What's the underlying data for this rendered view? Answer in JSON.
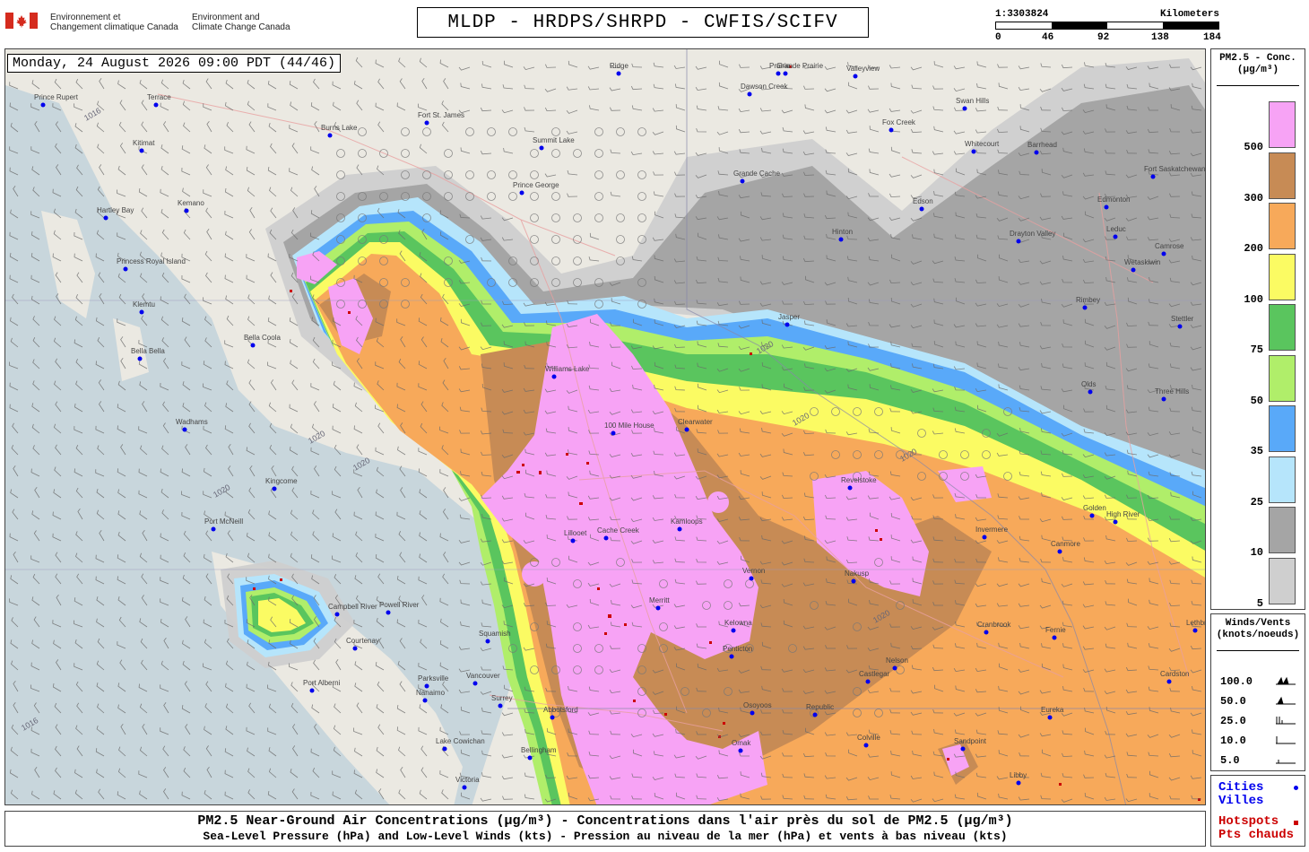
{
  "agency": {
    "fr": [
      "Environnement et",
      "Changement climatique Canada"
    ],
    "en": [
      "Environment and",
      "Climate Change Canada"
    ]
  },
  "title": "MLDP - HRDPS/SHRPD - CWFIS/SCIFV",
  "scale": {
    "ratio": "1:3303824",
    "unit": "Kilometers",
    "ticks": [
      "0",
      "46",
      "92",
      "138",
      "184"
    ]
  },
  "timestamp": "Monday, 24 August 2026 09:00 PDT (44/46)",
  "legend": {
    "title": [
      "PM2.5 - Conc.",
      "(µg/m³)"
    ],
    "bins": [
      {
        "label": "500",
        "color": "#f7a3f5"
      },
      {
        "label": "300",
        "color": "#c78b55"
      },
      {
        "label": "200",
        "color": "#f7a95a"
      },
      {
        "label": "100",
        "color": "#fbfb63"
      },
      {
        "label": "75",
        "color": "#5ac55e"
      },
      {
        "label": "50",
        "color": "#b0ee6a"
      },
      {
        "label": "35",
        "color": "#59a9f9"
      },
      {
        "label": "25",
        "color": "#b6e5fb"
      },
      {
        "label": "10",
        "color": "#a5a5a5"
      },
      {
        "label": "5",
        "color": "#cfcfcf"
      }
    ]
  },
  "winds": {
    "title": [
      "Winds/Vents",
      "(knots/noeuds)"
    ],
    "rows": [
      "100.0",
      "50.0",
      "25.0",
      "10.0",
      "5.0"
    ]
  },
  "symbols": {
    "cities": [
      "Cities",
      "Villes"
    ],
    "cities_color": "#0000ee",
    "hotspots": [
      "Hotspots",
      "Pts chauds"
    ],
    "hotspots_color": "#cc0000"
  },
  "caption": {
    "line1": "PM2.5 Near-Ground Air Concentrations (µg/m³) - Concentrations dans l'air près du sol de PM2.5 (µg/m³)",
    "line2": "Sea-Level Pressure (hPa) and Low-Level Winds (kts) - Pression au niveau de la mer (hPa) et vents à bas niveau (kts)"
  },
  "places": [
    "Prince Rupert",
    "Terrace",
    "Kitimat",
    "Kemano",
    "Hartley Bay",
    "Princess Royal Island",
    "Klemtu",
    "Bella Bella",
    "Bella Coola",
    "Wadhams",
    "Port McNeill",
    "Kingcome",
    "Courtenay",
    "Port Alberni",
    "Parksville",
    "Nanaimo",
    "Lake Cowichan",
    "Victoria",
    "Vancouver",
    "Surrey",
    "Abbotsford",
    "Bellingham",
    "Squamish",
    "Powell River",
    "Campbell River",
    "Burns Lake",
    "Fort St. James",
    "Prince George",
    "Summit Lake",
    "Williams Lake",
    "100 Mile House",
    "Clearwater",
    "Kamloops",
    "Cache Creek",
    "Lillooet",
    "Merritt",
    "Kelowna",
    "Penticton",
    "Osoyoos",
    "Vernon",
    "Nakusp",
    "Nelson",
    "Castlegar",
    "Cranbrook",
    "Fernie",
    "Golden",
    "Invermere",
    "Revelstoke",
    "Omak",
    "Republic",
    "Colville",
    "Sandpoint",
    "Libby",
    "Eureka",
    "Grande Cache",
    "Grande Prairie",
    "Valleyview",
    "Fox Creek",
    "Swan Hills",
    "Whitecourt",
    "Barrhead",
    "Edson",
    "Drayton Valley",
    "Edmonton",
    "Fort Saskatchewan",
    "Leduc",
    "Wetaskiwin",
    "Camrose",
    "Rimbey",
    "Stettler",
    "Olds",
    "Three Hills",
    "High River",
    "Canmore",
    "Lethbridge",
    "Cardston",
    "Hinton",
    "Jasper",
    "Dawson Creek",
    "Ridge",
    "Prairie"
  ],
  "isobars": [
    "1016",
    "1020",
    "1020",
    "1020",
    "1020",
    "1016",
    "1020",
    "1020",
    "1020"
  ]
}
